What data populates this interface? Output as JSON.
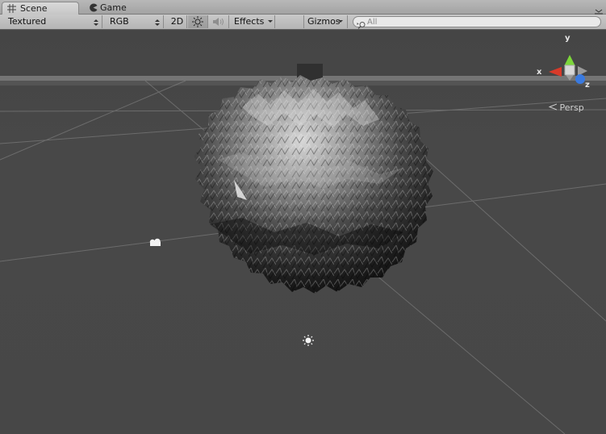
{
  "tabs": {
    "scene_label": "Scene",
    "game_label": "Game"
  },
  "toolbar": {
    "draw_mode": "Textured",
    "render_mode": "RGB",
    "mode_2d_label": "2D",
    "effects_label": "Effects",
    "gizmos_label": "Gizmos",
    "search_placeholder": "All"
  },
  "viewport": {
    "projection_label": "Persp",
    "axis_x_label": "x",
    "axis_y_label": "y",
    "axis_z_label": "z"
  },
  "icons": {
    "scene_tab": "grid-icon",
    "game_tab": "pacman-icon",
    "lighting_toggle": "sun-icon",
    "audio_toggle": "speaker-icon",
    "search": "search-icon",
    "camera_gizmo": "camera-icon",
    "light_gizmo": "sun-icon"
  },
  "colors": {
    "axis_x": "#d83a2a",
    "axis_y": "#7cd63a",
    "axis_z": "#3a7ae0",
    "viewport_bg": "#474747"
  }
}
